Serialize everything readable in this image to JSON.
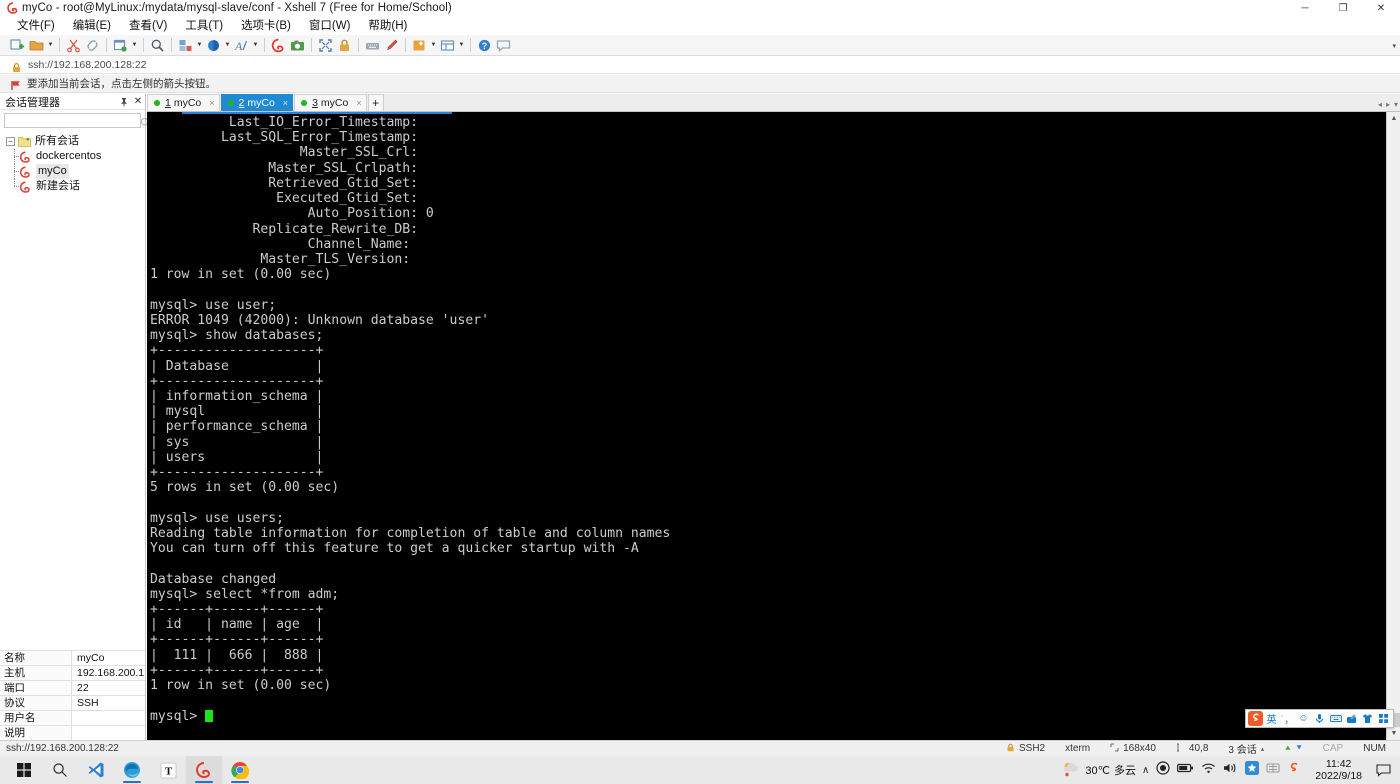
{
  "window": {
    "title": "myCo - root@MyLinux:/mydata/mysql-slave/conf - Xshell 7 (Free for Home/School)",
    "minimize": "─",
    "maximize": "❐",
    "close": "✕"
  },
  "menu": {
    "items": [
      {
        "label": "文件(F)"
      },
      {
        "label": "编辑(E)"
      },
      {
        "label": "查看(V)"
      },
      {
        "label": "工具(T)"
      },
      {
        "label": "选项卡(B)"
      },
      {
        "label": "窗口(W)"
      },
      {
        "label": "帮助(H)"
      }
    ]
  },
  "toolbar": {
    "buttons": [
      {
        "name": "new-session-icon",
        "tip": "新建会话"
      },
      {
        "name": "open-folder-icon",
        "tip": "打开"
      },
      {
        "name": "cut-icon",
        "tip": "剪切"
      },
      {
        "name": "paste-icon",
        "tip": "粘贴"
      },
      {
        "name": "session-manager-icon",
        "tip": "会话管理器"
      },
      {
        "name": "find-icon",
        "tip": "查找"
      },
      {
        "name": "layout-icon",
        "tip": "布局"
      },
      {
        "name": "color-scheme-icon",
        "tip": "配色方案"
      },
      {
        "name": "font-icon",
        "tip": "字体"
      },
      {
        "name": "xshell-icon",
        "tip": "Xshell"
      },
      {
        "name": "capture-icon",
        "tip": "截图"
      },
      {
        "name": "fullscreen-icon",
        "tip": "全屏"
      },
      {
        "name": "lock-icon",
        "tip": "锁定"
      },
      {
        "name": "keyboard-icon",
        "tip": "键盘"
      },
      {
        "name": "highlight-icon",
        "tip": "高亮"
      },
      {
        "name": "transfer-icon",
        "tip": "传输"
      },
      {
        "name": "split-view-icon",
        "tip": "分屏"
      },
      {
        "name": "help-icon",
        "tip": "帮助"
      },
      {
        "name": "comment-icon",
        "tip": "评论"
      }
    ],
    "overflow": "▾"
  },
  "address": {
    "url": "ssh://192.168.200.128:22"
  },
  "notify": {
    "text": "要添加当前会话，点击左侧的箭头按钮。"
  },
  "sidebar": {
    "title": "会话管理器",
    "pin": "📌",
    "close": "✕",
    "search_placeholder": "",
    "search_value": "",
    "tree": {
      "root": {
        "label": "所有会话",
        "expander": "−"
      },
      "children": [
        {
          "label": "dockercentos",
          "selected": false
        },
        {
          "label": "myCo",
          "selected": true
        },
        {
          "label": "新建会话",
          "selected": false
        }
      ]
    },
    "properties": [
      {
        "key": "名称",
        "value": "myCo"
      },
      {
        "key": "主机",
        "value": "192.168.200.1..."
      },
      {
        "key": "端口",
        "value": "22"
      },
      {
        "key": "协议",
        "value": "SSH"
      },
      {
        "key": "用户名",
        "value": ""
      },
      {
        "key": "说明",
        "value": ""
      }
    ]
  },
  "tabs": {
    "items": [
      {
        "num": "1",
        "label": "myCo",
        "active": false,
        "close": "×"
      },
      {
        "num": "2",
        "label": "myCo",
        "active": true,
        "close": "×"
      },
      {
        "num": "3",
        "label": "myCo",
        "active": false,
        "close": "×"
      }
    ],
    "add_label": "+",
    "nav_prev": "◂",
    "nav_next": "▸",
    "nav_menu": "▾"
  },
  "terminal": {
    "cursor_prompt": "mysql> ",
    "lines": [
      "          Last_IO_Error_Timestamp: ",
      "         Last_SQL_Error_Timestamp: ",
      "                   Master_SSL_Crl: ",
      "               Master_SSL_Crlpath: ",
      "               Retrieved_Gtid_Set: ",
      "                Executed_Gtid_Set: ",
      "                    Auto_Position: 0",
      "             Replicate_Rewrite_DB: ",
      "                    Channel_Name: ",
      "              Master_TLS_Version: ",
      "1 row in set (0.00 sec)",
      "",
      "mysql> use user;",
      "ERROR 1049 (42000): Unknown database 'user'",
      "mysql> show databases;",
      "+--------------------+",
      "| Database           |",
      "+--------------------+",
      "| information_schema |",
      "| mysql              |",
      "| performance_schema |",
      "| sys                |",
      "| users              |",
      "+--------------------+",
      "5 rows in set (0.00 sec)",
      "",
      "mysql> use users;",
      "Reading table information for completion of table and column names",
      "You can turn off this feature to get a quicker startup with -A",
      "",
      "Database changed",
      "mysql> select *from adm;",
      "+------+------+------+",
      "| id   | name | age  |",
      "+------+------+------+",
      "|  111 |  666 |  888 |",
      "+------+------+------+",
      "1 row in set (0.00 sec)",
      ""
    ],
    "scroll": {
      "up": "▲",
      "down": "▼"
    }
  },
  "ime": {
    "logo": "S",
    "mode": "英",
    "buttons": [
      {
        "name": "ime-mode-toggle",
        "glyph": "英"
      },
      {
        "name": "ime-punctuation-icon",
        "glyph": "˙，"
      },
      {
        "name": "ime-emoji-icon",
        "glyph": "☺"
      },
      {
        "name": "ime-voice-icon",
        "glyph": "🎤"
      },
      {
        "name": "ime-keyboard-icon",
        "glyph": "⌨"
      },
      {
        "name": "ime-handwriting-icon",
        "glyph": "✎"
      },
      {
        "name": "ime-skin-icon",
        "glyph": "👕"
      },
      {
        "name": "ime-toolbox-icon",
        "glyph": "▦"
      }
    ]
  },
  "statusbar": {
    "left": "ssh://192.168.200.128:22",
    "protocol": "SSH2",
    "term_type": "xterm",
    "size": "168x40",
    "cursor_pos": "40,8",
    "sessions": "3 会话",
    "caret": "▴",
    "cap": "CAP",
    "num": "NUM"
  },
  "taskbar": {
    "buttons": [
      {
        "name": "start-button"
      },
      {
        "name": "search-icon"
      },
      {
        "name": "vscode-icon"
      },
      {
        "name": "edge-icon"
      },
      {
        "name": "typora-icon"
      },
      {
        "name": "xshell-icon"
      },
      {
        "name": "chrome-icon"
      }
    ],
    "weather": {
      "temp": "30℃",
      "desc": "多云"
    },
    "tray_expand": "∧",
    "clock_time": "11:42",
    "clock_date": "2022/9/18",
    "notify": "💬"
  },
  "colors": {
    "accent": "#1f8ad2",
    "terminal_bg": "#000000",
    "terminal_fg": "#cccccc",
    "cursor": "#19e619",
    "session_green": "#22b422"
  }
}
